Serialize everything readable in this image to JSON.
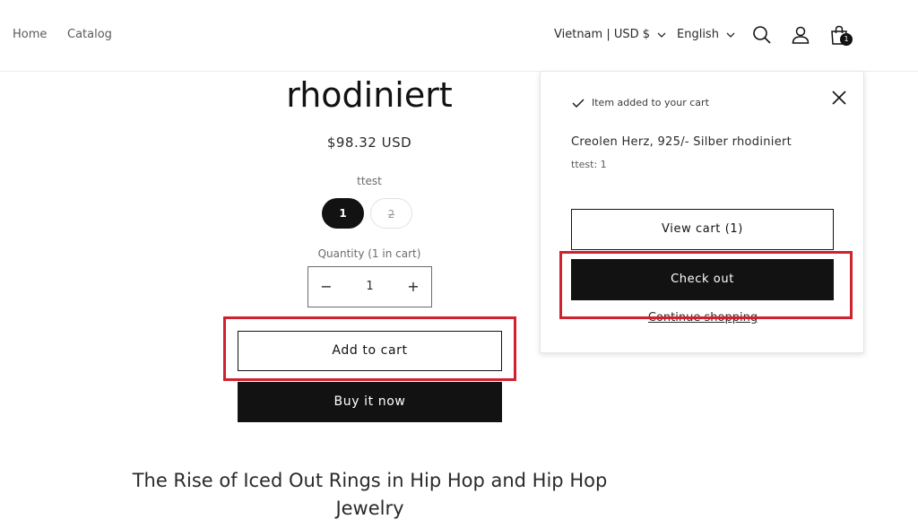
{
  "header": {
    "nav": [
      {
        "label": "Home"
      },
      {
        "label": "Catalog"
      }
    ],
    "country_selector": "Vietnam | USD $",
    "language_selector": "English",
    "cart_count": "1",
    "icons": [
      "search-icon",
      "account-icon",
      "cart-icon",
      "chevron-down-icon"
    ]
  },
  "product": {
    "title": "rhodiniert",
    "price": "$98.32 USD",
    "variant_label": "ttest",
    "variants": [
      {
        "label": "1",
        "selected": true
      },
      {
        "label": "2",
        "selected": false,
        "unavailable": true
      }
    ],
    "quantity_label": "Quantity (1 in cart)",
    "quantity": "1",
    "qty_minus": "−",
    "qty_plus": "+",
    "add_to_cart": "Add to cart",
    "buy_now": "Buy it now"
  },
  "article": {
    "title": "The Rise of Iced Out Rings in Hip Hop and Hip Hop Jewelry"
  },
  "cart_popup": {
    "status": "Item added to your cart",
    "product_name": "Creolen Herz, 925/- Silber rhodiniert",
    "variant": "ttest: 1",
    "view_cart": "View cart (1)",
    "checkout": "Check out",
    "continue_shopping": "Continue shopping"
  },
  "colors": {
    "primary": "#121212",
    "highlight": "#d0212f",
    "background": "#ffffff"
  }
}
